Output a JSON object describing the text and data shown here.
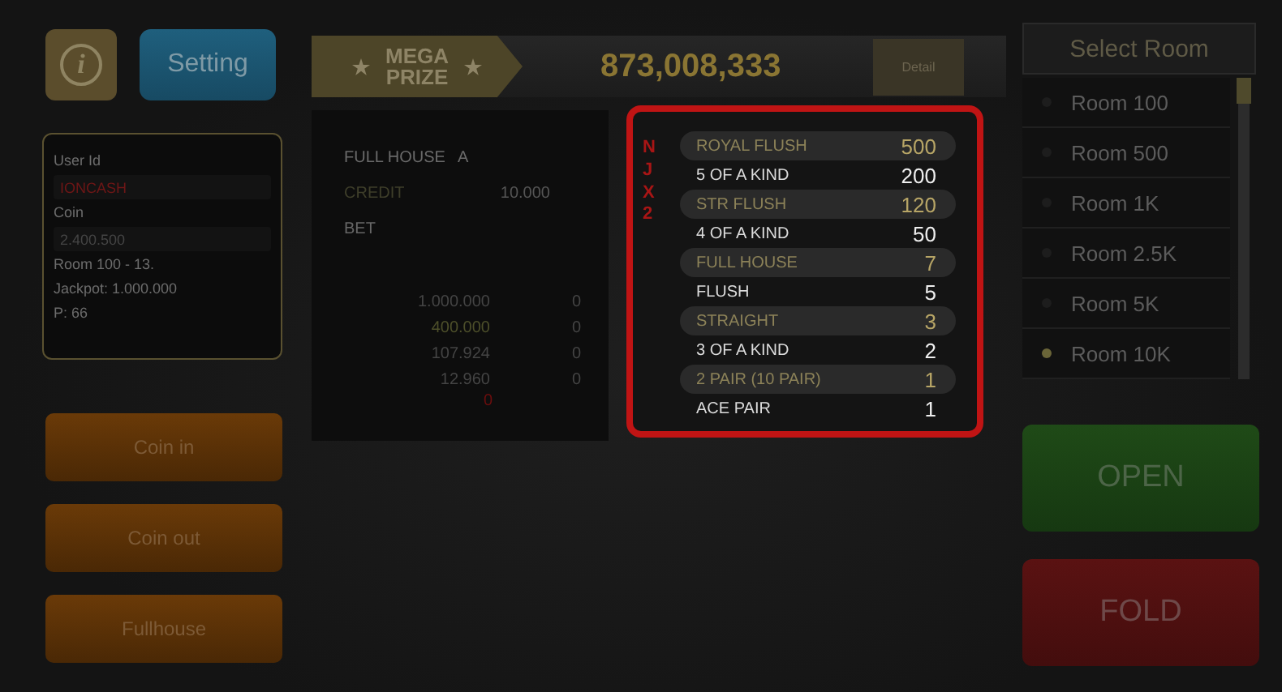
{
  "top_buttons": {
    "info": {
      "label": "i"
    },
    "setting": {
      "label": "Setting"
    }
  },
  "mega_prize": {
    "title": "MEGA PRIZE",
    "amount": "873,008,333",
    "detail_button": "Detail"
  },
  "user_card": {
    "user_id_label": "User Id",
    "user_id": "IONCASH",
    "coin_label": "Coin",
    "coin": "2.400.500",
    "room": "Room 100 - 13.",
    "jackpot": "Jackpot: 1.000.000",
    "points": "P: 66"
  },
  "side_buttons": [
    "Coin in",
    "Coin out",
    "Fullhouse"
  ],
  "stats": {
    "hand": "FULL HOUSE",
    "hand_rank": "A",
    "credit_label": "CREDIT",
    "credit": "10.000",
    "bet_label": "BET",
    "rows": [
      {
        "amount": "1.000.000",
        "count": "0",
        "highlight": false
      },
      {
        "amount": "400.000",
        "count": "0",
        "highlight": true
      },
      {
        "amount": "107.924",
        "count": "0",
        "highlight": false
      },
      {
        "amount": "12.960",
        "count": "0",
        "highlight": false
      }
    ],
    "marker": "0"
  },
  "paytable": {
    "side_letters": "NJX2",
    "rows": [
      {
        "hand": "ROYAL FLUSH",
        "payout": "500",
        "highlight": true
      },
      {
        "hand": "5 OF A KIND",
        "payout": "200",
        "highlight": false
      },
      {
        "hand": "STR FLUSH",
        "payout": "120",
        "highlight": true
      },
      {
        "hand": "4 OF A KIND",
        "payout": "50",
        "highlight": false
      },
      {
        "hand": "FULL HOUSE",
        "payout": "7",
        "highlight": true
      },
      {
        "hand": "FLUSH",
        "payout": "5",
        "highlight": false
      },
      {
        "hand": "STRAIGHT",
        "payout": "3",
        "highlight": true
      },
      {
        "hand": "3 OF A KIND",
        "payout": "2",
        "highlight": false
      },
      {
        "hand": "2 PAIR (10 PAIR)",
        "payout": "1",
        "highlight": true
      },
      {
        "hand": "ACE PAIR",
        "payout": "1",
        "highlight": false
      }
    ]
  },
  "room_select": {
    "title": "Select Room",
    "rooms": [
      {
        "label": "Room 100",
        "selected": false
      },
      {
        "label": "Room 500",
        "selected": false
      },
      {
        "label": "Room 1K",
        "selected": false
      },
      {
        "label": "Room 2.5K",
        "selected": false
      },
      {
        "label": "Room 5K",
        "selected": false
      },
      {
        "label": "Room 10K",
        "selected": true
      }
    ]
  },
  "actions": [
    {
      "label": "OPEN",
      "kind": "open"
    },
    {
      "label": "FOLD",
      "kind": "fold"
    }
  ]
}
